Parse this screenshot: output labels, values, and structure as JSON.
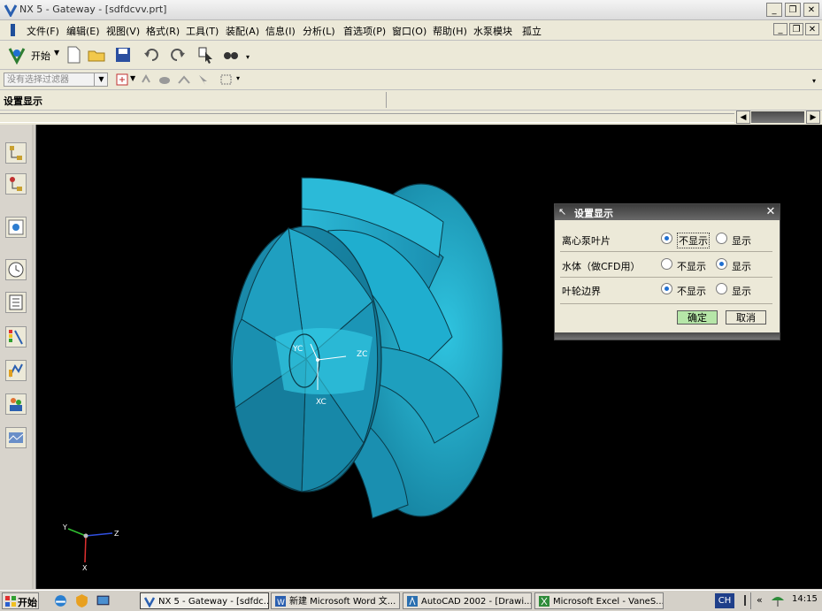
{
  "window": {
    "title": "NX 5 - Gateway - [sdfdcvv.prt]"
  },
  "menu": {
    "items": [
      "文件(F)",
      "编辑(E)",
      "视图(V)",
      "格式(R)",
      "工具(T)",
      "装配(A)",
      "信息(I)",
      "分析(L)",
      "首选项(P)",
      "窗口(O)",
      "帮助(H)",
      "水泵模块",
      "孤立"
    ]
  },
  "toolbar": {
    "start_label": "开始"
  },
  "selection": {
    "filter_placeholder": "没有选择过滤器"
  },
  "cue": {
    "text": "设置显示"
  },
  "viewport": {
    "labels": {
      "yc": "YC",
      "zc": "ZC",
      "xc": "XC"
    },
    "triad": {
      "x": "X",
      "y": "Y",
      "z": "Z"
    }
  },
  "dialog": {
    "title": "设置显示",
    "rows": [
      {
        "label": "离心泵叶片",
        "option1": "不显示",
        "option2": "显示",
        "selected": "不显示"
      },
      {
        "label": "水体（做CFD用）",
        "option1": "不显示",
        "option2": "显示",
        "selected": "显示"
      },
      {
        "label": "叶轮边界",
        "option1": "不显示",
        "option2": "显示",
        "selected": "不显示"
      }
    ],
    "ok": "确定",
    "cancel": "取消"
  },
  "taskbar": {
    "start": "开始",
    "tasks": [
      "NX 5 - Gateway - [sdfdc...",
      "新建 Microsoft Word 文...",
      "AutoCAD 2002 - [Drawi...",
      "Microsoft Excel - VaneS..."
    ],
    "lang": "CH",
    "arrows": "«",
    "clock": "14:15"
  },
  "colors": {
    "impeller": "#1e9fbe",
    "viewport_bg": "#000000",
    "ok_button": "#b6e6a8"
  }
}
